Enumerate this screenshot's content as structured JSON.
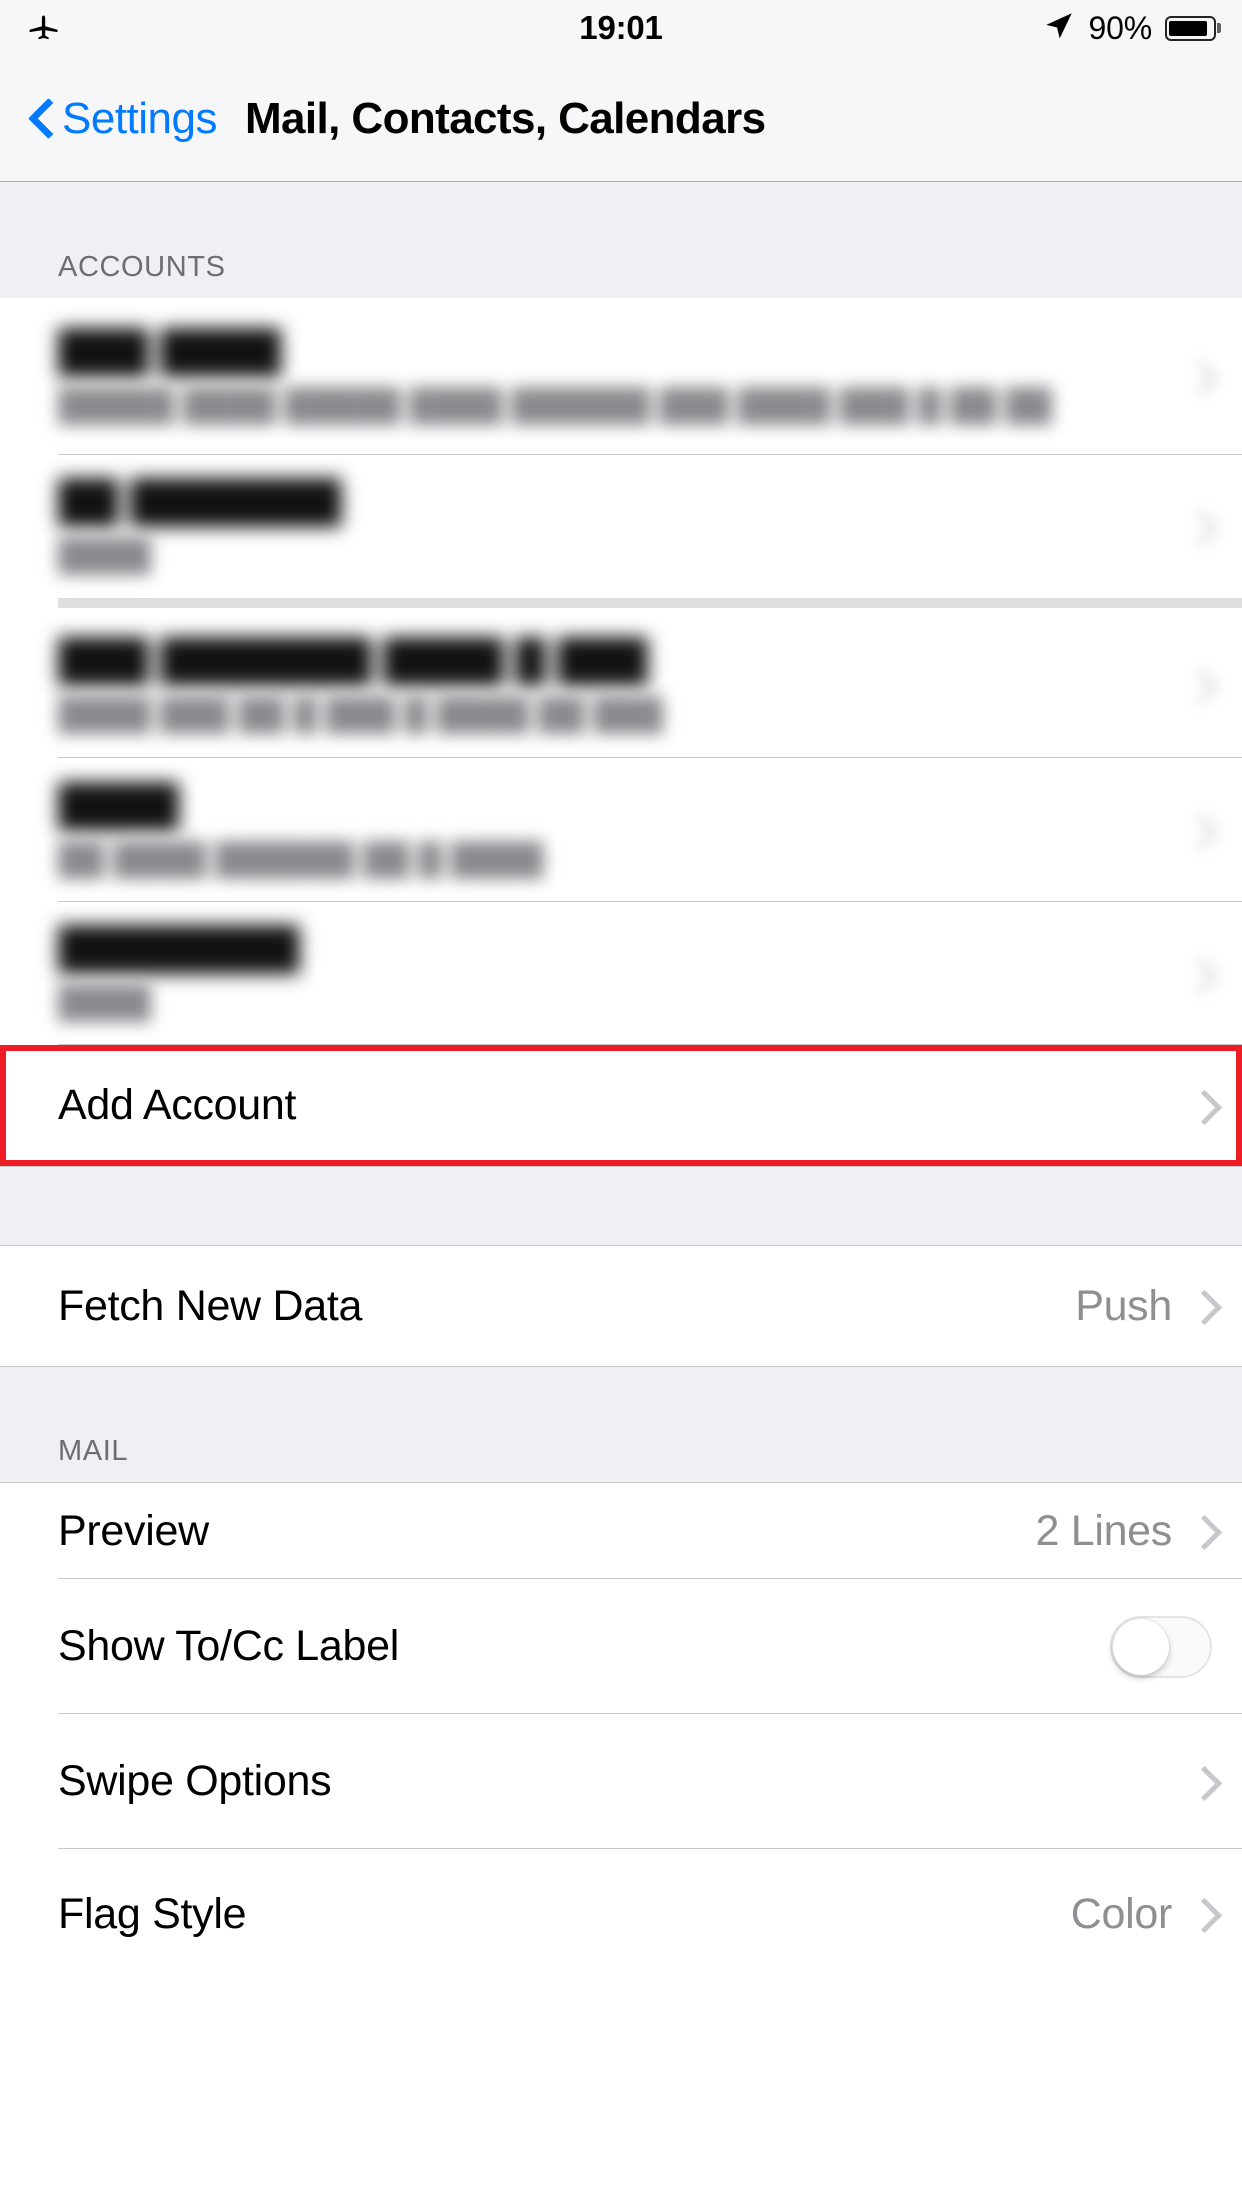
{
  "status_bar": {
    "airplane_icon": "airplane-icon",
    "time": "19:01",
    "location_icon": "location-arrow-icon",
    "battery_percent": "90%",
    "battery_level": 90
  },
  "nav_bar": {
    "back_label": "Settings",
    "back_icon": "chevron-left-icon",
    "title": "Mail, Contacts, Calendars"
  },
  "sections": {
    "accounts": {
      "header": "ACCOUNTS",
      "rows": [
        {
          "title": "███ ████",
          "subtitle": "█████ ████ █████ ████ ██████ ███ ████ ███ █ ██ ██",
          "redacted": true
        },
        {
          "title": "██ ███████",
          "subtitle": "████",
          "redacted": true
        },
        {
          "title": "███ ███████ ████ █ ███",
          "subtitle": "████ ███ ██ █ ███ █ ████ ██ ███",
          "redacted": true
        },
        {
          "title": "████",
          "subtitle": "██ ████ ██████ ██ █ ████",
          "redacted": true
        },
        {
          "title": "████████",
          "subtitle": "████",
          "redacted": true
        }
      ],
      "add_account": {
        "label": "Add Account",
        "chevron_icon": "chevron-right-icon",
        "highlighted": true,
        "highlight_color": "#ee1c25"
      }
    },
    "fetch": {
      "rows": [
        {
          "label": "Fetch New Data",
          "value": "Push",
          "accessory": "chevron-right-icon"
        }
      ]
    },
    "mail": {
      "header": "MAIL",
      "rows": [
        {
          "label": "Preview",
          "value": "2 Lines",
          "accessory": "chevron-right-icon"
        },
        {
          "label": "Show To/Cc Label",
          "value": "",
          "accessory": "toggle",
          "toggle_on": false
        },
        {
          "label": "Swipe Options",
          "value": "",
          "accessory": "chevron-right-icon"
        },
        {
          "label": "Flag Style",
          "value": "Color",
          "accessory": "chevron-right-icon"
        }
      ]
    }
  },
  "colors": {
    "accent_blue": "#007aff",
    "group_bg": "#efeff4",
    "separator": "#c8c7cc",
    "secondary_text": "#8e8e93",
    "header_text": "#6d6d72",
    "highlight_red": "#ee1c25"
  }
}
